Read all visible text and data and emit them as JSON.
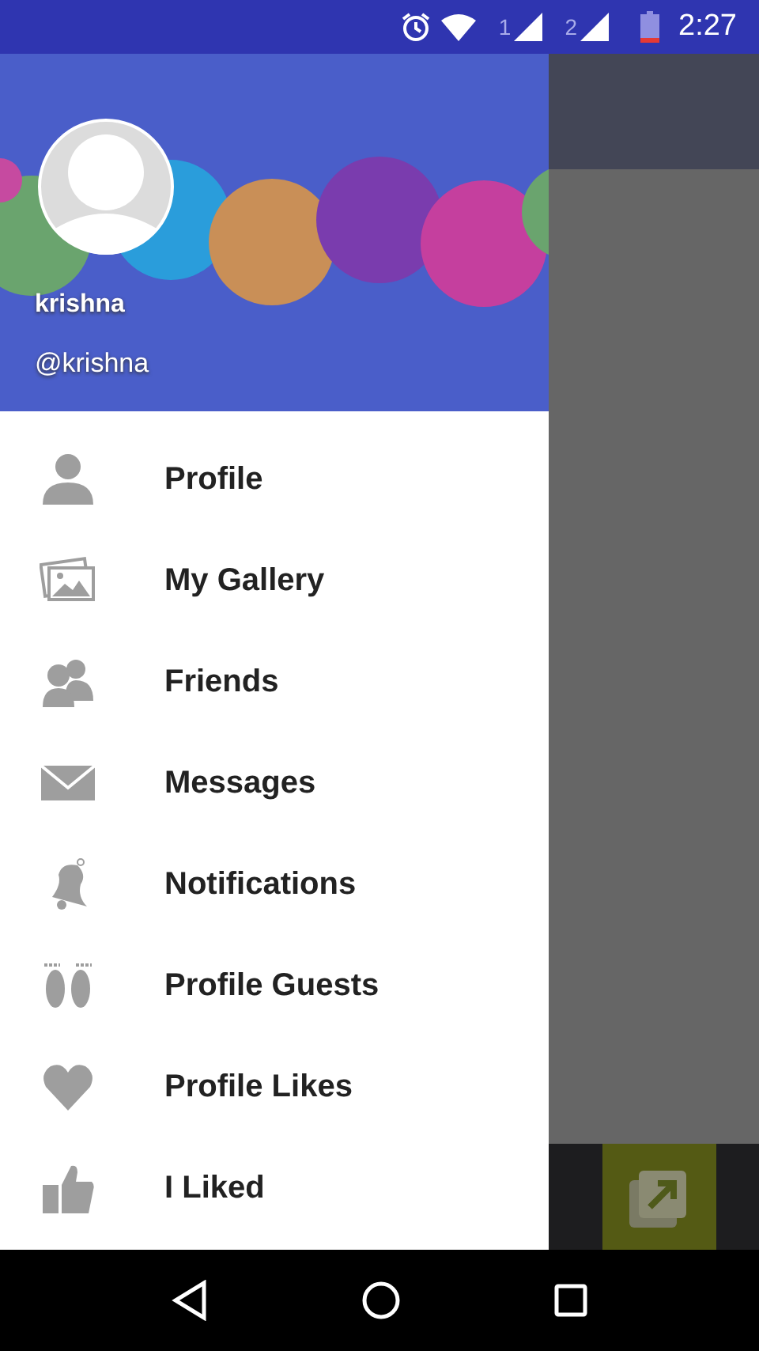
{
  "status_bar": {
    "sims": [
      "1",
      "2"
    ],
    "time": "2:27"
  },
  "drawer": {
    "header": {
      "name": "krishna",
      "handle": "@krishna"
    },
    "items": [
      {
        "kind": "person",
        "label": "Profile"
      },
      {
        "kind": "gallery",
        "label": "My Gallery"
      },
      {
        "kind": "people",
        "label": "Friends"
      },
      {
        "kind": "mail",
        "label": "Messages"
      },
      {
        "kind": "bell",
        "label": "Notifications"
      },
      {
        "kind": "feet",
        "label": "Profile Guests"
      },
      {
        "kind": "heart",
        "label": "Profile Likes"
      },
      {
        "kind": "thumb",
        "label": "I Liked"
      }
    ]
  }
}
